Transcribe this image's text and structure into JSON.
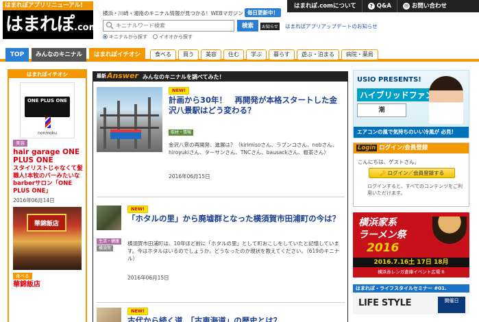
{
  "header": {
    "logo_top": "はまれぽアプリリニューアル!",
    "logo_main": "はまれぽ",
    "logo_suffix": ".com",
    "tagline": "横浜・川崎・湘南のキニナル情報が見つかる！WEBマガジン",
    "daily_badge": "毎日更新中！",
    "top_nav": [
      {
        "label": "はまれぽ.comについて",
        "icon": ""
      },
      {
        "label": "Q&A",
        "icon": "question-icon"
      },
      {
        "label": "お問い合わせ",
        "icon": "mail-icon"
      }
    ],
    "search": {
      "placeholder": "キニナルワード検索",
      "button": "検索",
      "radio_all": "キニナルから探す",
      "radio_events": "イオオから探す"
    },
    "notice_badge": "お知らせ",
    "notice_text": "はまれぽアプリアップデートのお知らせ"
  },
  "nav": {
    "top": "TOP",
    "tab_minna": "みんなのキニナル",
    "tab_ichioshi": "はまれぽイチオシ",
    "categories": [
      "食べる",
      "買う",
      "美容",
      "住む",
      "学ぶ",
      "暮らす",
      "遊ぶ・泊まる",
      "病院・薬局"
    ]
  },
  "left": {
    "heading": "はまれぽイチオシ",
    "item1": {
      "brand": "ONE PLUS ONE",
      "brand_sub": "nonmoku",
      "tag": "美容",
      "title": "hair garage ONE PLUS ONE",
      "desc": "スタイリストじゃなくて髪職人!本牧のバーみたいなbarberサロン「ONE PLUS ONE」",
      "date": "2016年06月14日"
    },
    "item2": {
      "sign": "華錦飯店",
      "tag": "食べる",
      "title": "華錦飯店"
    }
  },
  "main": {
    "head_new": "最新",
    "head_answer": "Answer",
    "head_desc": "みんなのキニナルを調べてみた！",
    "articles": [
      {
        "new": "NEW!",
        "title": "計画から30年！　再開発が本格スタートした金沢八景駅はどう変わる？",
        "tag": "取材・情報",
        "excerpt": "金沢八景の再開発、進展は？（kirimisoさん、ラブンコさん、nobさん、hiroyukiさん、ターサンさん、TNCさん、bausackさん、粗茶さん）",
        "date": "2016年06月15日"
      },
      {
        "new": "NEW!",
        "title": "「ホタルの里」から廃墟群となった横須賀市田浦町の今は？",
        "tag1": "生活・健康",
        "tag2": "横須賀",
        "excerpt": "横須賀市田浦町は、10年ほど前に「ホタルの里」として町おこしをしていたと記憶しています。今はホタルはいるのでしょうか。どうなったのか現状を教えてください。（619のキニナル）",
        "date": "2016年06月15日"
      },
      {
        "new": "NEW!",
        "title": "古代から続く道、「古東海道」の歴史とは？"
      }
    ]
  },
  "right": {
    "ad1": {
      "brand": "USIO PRESENTS!",
      "title": "ハイブリッドファン",
      "logo": "潮",
      "footer": "エアコンの風で気持ちのいい冷風が 必見!"
    },
    "login": {
      "label_en": "Login",
      "label_jp": "ログイン/会員登録",
      "greeting": "こんにちは、ゲストさん。",
      "button": "ログイン／会員登録する",
      "note": "ログインすると、すべてのコンテンツをご利用いただけます。"
    },
    "ad2": {
      "line1": "横浜家系",
      "line2": "ラーメン祭",
      "year": "2016",
      "date": "2016.7.16土 17日 18月",
      "venue": "横浜赤レンガ倉庫イベント広場 B"
    },
    "seminar": "はまれぽ・ライフスタイルセミナー #01.",
    "ad3": {
      "title": "LIFE STYLE",
      "badge": "開催日"
    }
  }
}
